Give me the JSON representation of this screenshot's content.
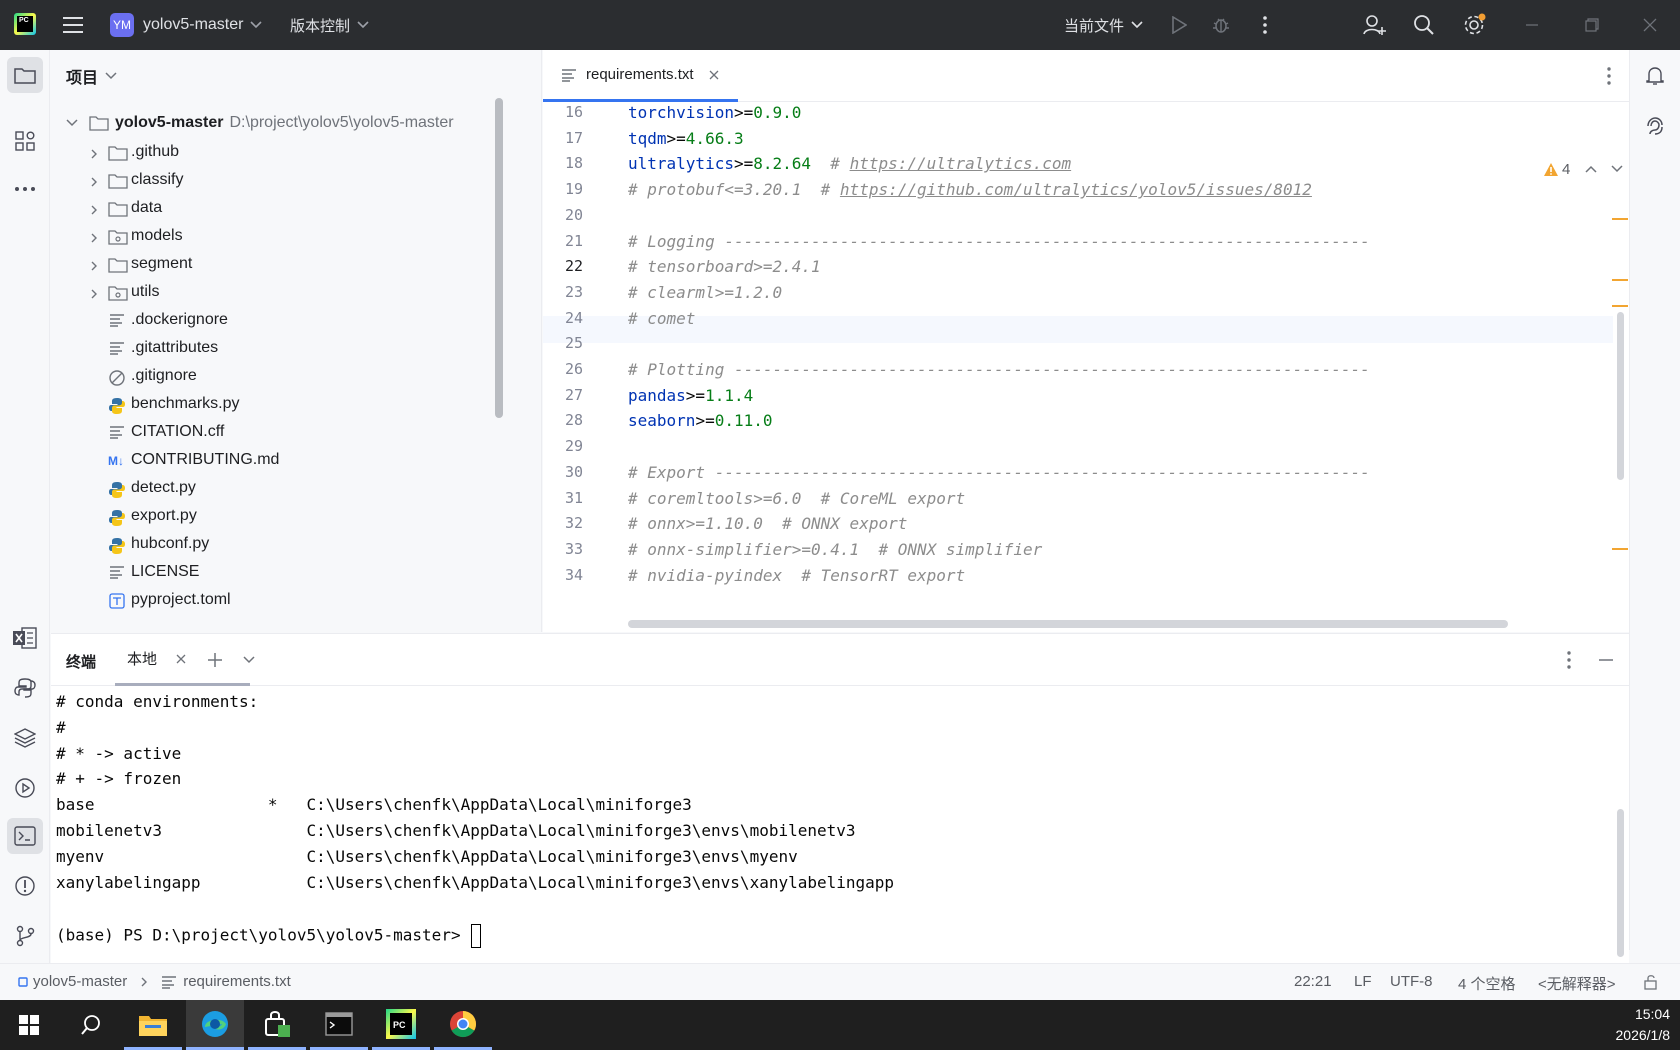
{
  "titlebar": {
    "app_badge": "PC",
    "project_badge": "YM",
    "project_name": "yolov5-master",
    "vcs_label": "版本控制",
    "run_config": "当前文件",
    "accent": "#3574f0"
  },
  "project_panel": {
    "title": "项目",
    "root_name": "yolov5-master",
    "root_path": "D:\\project\\yolov5\\yolov5-master",
    "items": [
      {
        "label": ".github",
        "icon": "folder-icon",
        "expandable": true
      },
      {
        "label": "classify",
        "icon": "folder-icon",
        "expandable": true
      },
      {
        "label": "data",
        "icon": "folder-icon",
        "expandable": true
      },
      {
        "label": "models",
        "icon": "package-folder-icon",
        "expandable": true
      },
      {
        "label": "segment",
        "icon": "folder-icon",
        "expandable": true
      },
      {
        "label": "utils",
        "icon": "package-folder-icon",
        "expandable": true
      },
      {
        "label": ".dockerignore",
        "icon": "text-file-icon",
        "expandable": false
      },
      {
        "label": ".gitattributes",
        "icon": "text-file-icon",
        "expandable": false
      },
      {
        "label": ".gitignore",
        "icon": "ignore-file-icon",
        "expandable": false
      },
      {
        "label": "benchmarks.py",
        "icon": "python-file-icon",
        "expandable": false
      },
      {
        "label": "CITATION.cff",
        "icon": "text-file-icon",
        "expandable": false
      },
      {
        "label": "CONTRIBUTING.md",
        "icon": "markdown-file-icon",
        "expandable": false
      },
      {
        "label": "detect.py",
        "icon": "python-file-icon",
        "expandable": false
      },
      {
        "label": "export.py",
        "icon": "python-file-icon",
        "expandable": false
      },
      {
        "label": "hubconf.py",
        "icon": "python-file-icon",
        "expandable": false
      },
      {
        "label": "LICENSE",
        "icon": "text-file-icon",
        "expandable": false
      },
      {
        "label": "pyproject.toml",
        "icon": "toml-file-icon",
        "expandable": false
      }
    ]
  },
  "editor": {
    "tab_label": "requirements.txt",
    "warning_count": "4",
    "lines": [
      {
        "n": "16",
        "parts": [
          [
            "k",
            "torchvision"
          ],
          [
            "o",
            ">="
          ],
          [
            "v",
            "0.9.0"
          ]
        ]
      },
      {
        "n": "17",
        "parts": [
          [
            "k",
            "tqdm"
          ],
          [
            "o",
            ">="
          ],
          [
            "v",
            "4.66.3"
          ]
        ]
      },
      {
        "n": "18",
        "parts": [
          [
            "k",
            "ultralytics"
          ],
          [
            "o",
            ">="
          ],
          [
            "v",
            "8.2.64"
          ],
          [
            "c",
            "  # "
          ],
          [
            "l",
            "https://ultralytics.com"
          ]
        ]
      },
      {
        "n": "19",
        "parts": [
          [
            "c",
            "# protobuf<=3.20.1  # "
          ],
          [
            "l",
            "https://github.com/ultralytics/yolov5/issues/8012"
          ]
        ]
      },
      {
        "n": "20",
        "parts": []
      },
      {
        "n": "21",
        "parts": [
          [
            "c",
            "# Logging -------------------------------------------------------------------"
          ]
        ]
      },
      {
        "n": "22",
        "parts": [
          [
            "c",
            "# tensorboard>=2.4.1"
          ]
        ]
      },
      {
        "n": "23",
        "parts": [
          [
            "c",
            "# clearml>=1.2.0"
          ]
        ]
      },
      {
        "n": "24",
        "parts": [
          [
            "c",
            "# comet"
          ]
        ]
      },
      {
        "n": "25",
        "parts": []
      },
      {
        "n": "26",
        "parts": [
          [
            "c",
            "# Plotting ------------------------------------------------------------------"
          ]
        ]
      },
      {
        "n": "27",
        "parts": [
          [
            "k",
            "pandas"
          ],
          [
            "o",
            ">="
          ],
          [
            "v",
            "1.1.4"
          ]
        ]
      },
      {
        "n": "28",
        "parts": [
          [
            "k",
            "seaborn"
          ],
          [
            "o",
            ">="
          ],
          [
            "v",
            "0.11.0"
          ]
        ]
      },
      {
        "n": "29",
        "parts": []
      },
      {
        "n": "30",
        "parts": [
          [
            "c",
            "# Export --------------------------------------------------------------------"
          ]
        ]
      },
      {
        "n": "31",
        "parts": [
          [
            "c",
            "# coremltools>=6.0  # CoreML export"
          ]
        ]
      },
      {
        "n": "32",
        "parts": [
          [
            "c",
            "# onnx>=1.10.0  # ONNX export"
          ]
        ]
      },
      {
        "n": "33",
        "parts": [
          [
            "c",
            "# onnx-simplifier>=0.4.1  # ONNX simplifier"
          ]
        ]
      },
      {
        "n": "34",
        "parts": [
          [
            "c",
            "# nvidia-pyindex  # TensorRT export"
          ]
        ]
      }
    ],
    "current_line": "22"
  },
  "terminal": {
    "title": "终端",
    "tab_label": "本地",
    "lines": [
      "# conda environments:",
      "#",
      "# * -> active",
      "# + -> frozen",
      "base                  *   C:\\Users\\chenfk\\AppData\\Local\\miniforge3",
      "mobilenetv3               C:\\Users\\chenfk\\AppData\\Local\\miniforge3\\envs\\mobilenetv3",
      "myenv                     C:\\Users\\chenfk\\AppData\\Local\\miniforge3\\envs\\myenv",
      "xanylabelingapp           C:\\Users\\chenfk\\AppData\\Local\\miniforge3\\envs\\xanylabelingapp",
      "",
      "(base) PS D:\\project\\yolov5\\yolov5-master> "
    ]
  },
  "statusbar": {
    "breadcrumb_project": "yolov5-master",
    "breadcrumb_file": "requirements.txt",
    "position": "22:21",
    "line_separator": "LF",
    "encoding": "UTF-8",
    "indent": "4 个空格",
    "interpreter": "<无解释器>"
  },
  "taskbar": {
    "time": "15:04",
    "date": "2026/1/8",
    "pycharm_badge": "PC"
  }
}
